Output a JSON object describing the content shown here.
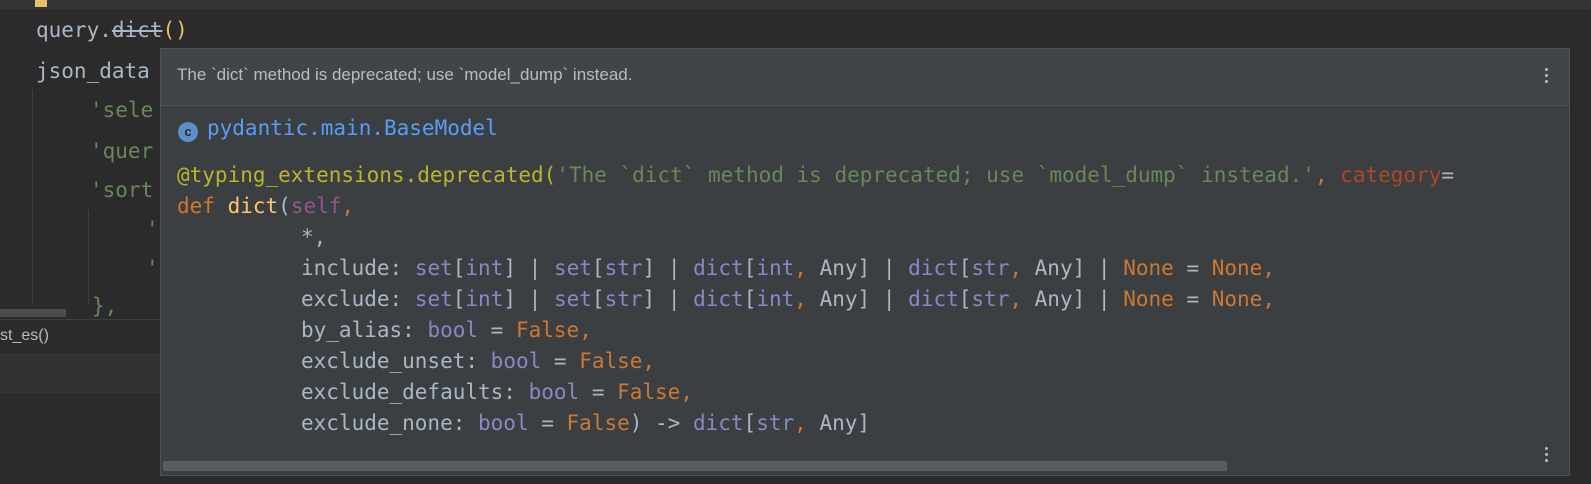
{
  "editor": {
    "lines": [
      {
        "prefix": "query.",
        "struck": "dict",
        "suffix": "()"
      },
      {
        "text": "json_data"
      },
      {
        "text": "'sele"
      },
      {
        "text": "'quer"
      },
      {
        "text": "'sort"
      },
      {
        "text": "'"
      },
      {
        "text": "'"
      },
      {
        "text": "},"
      }
    ],
    "run_label": "st_es()"
  },
  "popup": {
    "message": "The `dict` method is deprecated; use `model_dump` instead.",
    "class_icon_letter": "c",
    "class_path": "pydantic.main.BaseModel",
    "decorator": "@typing_extensions.deprecated(",
    "decorator_string": "'The `dict` method is deprecated; use `model_dump` instead.'",
    "decorator_comma": ", ",
    "decorator_kwarg": "category",
    "decorator_eq": "=",
    "def_kw": "def ",
    "fn_name": "dict",
    "open_paren": "(",
    "self_param": "self",
    "comma": ",",
    "star": "*,",
    "params": [
      {
        "name": "include",
        "type": "set[int] | set[str] | dict[int, Any] | dict[str, Any] | None",
        "default": "None"
      },
      {
        "name": "exclude",
        "type": "set[int] | set[str] | dict[int, Any] | dict[str, Any] | None",
        "default": "None"
      },
      {
        "name": "by_alias",
        "type": "bool",
        "default": "False"
      },
      {
        "name": "exclude_unset",
        "type": "bool",
        "default": "False"
      },
      {
        "name": "exclude_defaults",
        "type": "bool",
        "default": "False"
      },
      {
        "name": "exclude_none",
        "type": "bool",
        "default": "False"
      }
    ],
    "return_type": "dict[str, Any]",
    "arrow": ") -> "
  }
}
